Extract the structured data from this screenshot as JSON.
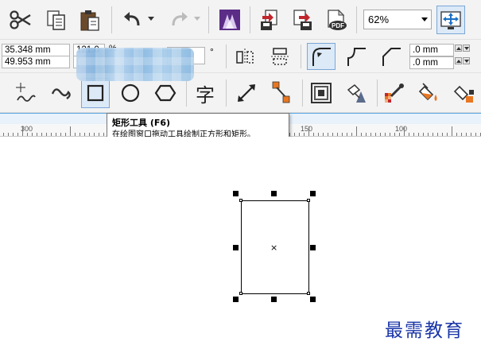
{
  "toolbar_standard": {
    "zoom_level": "62%",
    "icons": [
      "scissors-icon",
      "copy-icon",
      "paste-icon",
      "undo-icon",
      "redo-icon",
      "launcher-icon",
      "import-icon",
      "export-icon",
      "publish-pdf-icon",
      "zoom-combo",
      "full-screen-icon"
    ]
  },
  "property_bar": {
    "x_value": "35.348 mm",
    "y_value": "49.953 mm",
    "width_value": "121.0",
    "height_prefix": "(",
    "scale_unit": "%",
    "degree_symbol": "°",
    "outline_width_1": ".0 mm",
    "outline_width_2": ".0 mm"
  },
  "toolbox": {
    "text_tool_glyph": "字",
    "tools": [
      "pick-tool",
      "freehand-tool",
      "smart-drawing-tool",
      "rectangle-tool",
      "ellipse-tool",
      "polygon-tool",
      "text-tool",
      "dimension-tool",
      "connector-tool",
      "contour-tool",
      "transparency-tool",
      "eyedropper-tool",
      "fill-tool",
      "smart-fill-tool"
    ]
  },
  "ruler": {
    "labels": [
      "300",
      "150",
      "100"
    ]
  },
  "tooltip": {
    "title": "矩形工具 (F6)",
    "description": "在绘图窗口拖动工具绘制正方形和矩形。"
  },
  "watermark": "最需教育",
  "colors": {
    "accent_blue": "#1a35a8",
    "ruler_highlight": "#5aa7e2",
    "icon_orange": "#e87722",
    "icon_red": "#c0272d",
    "icon_purple": "#5b2d86"
  }
}
